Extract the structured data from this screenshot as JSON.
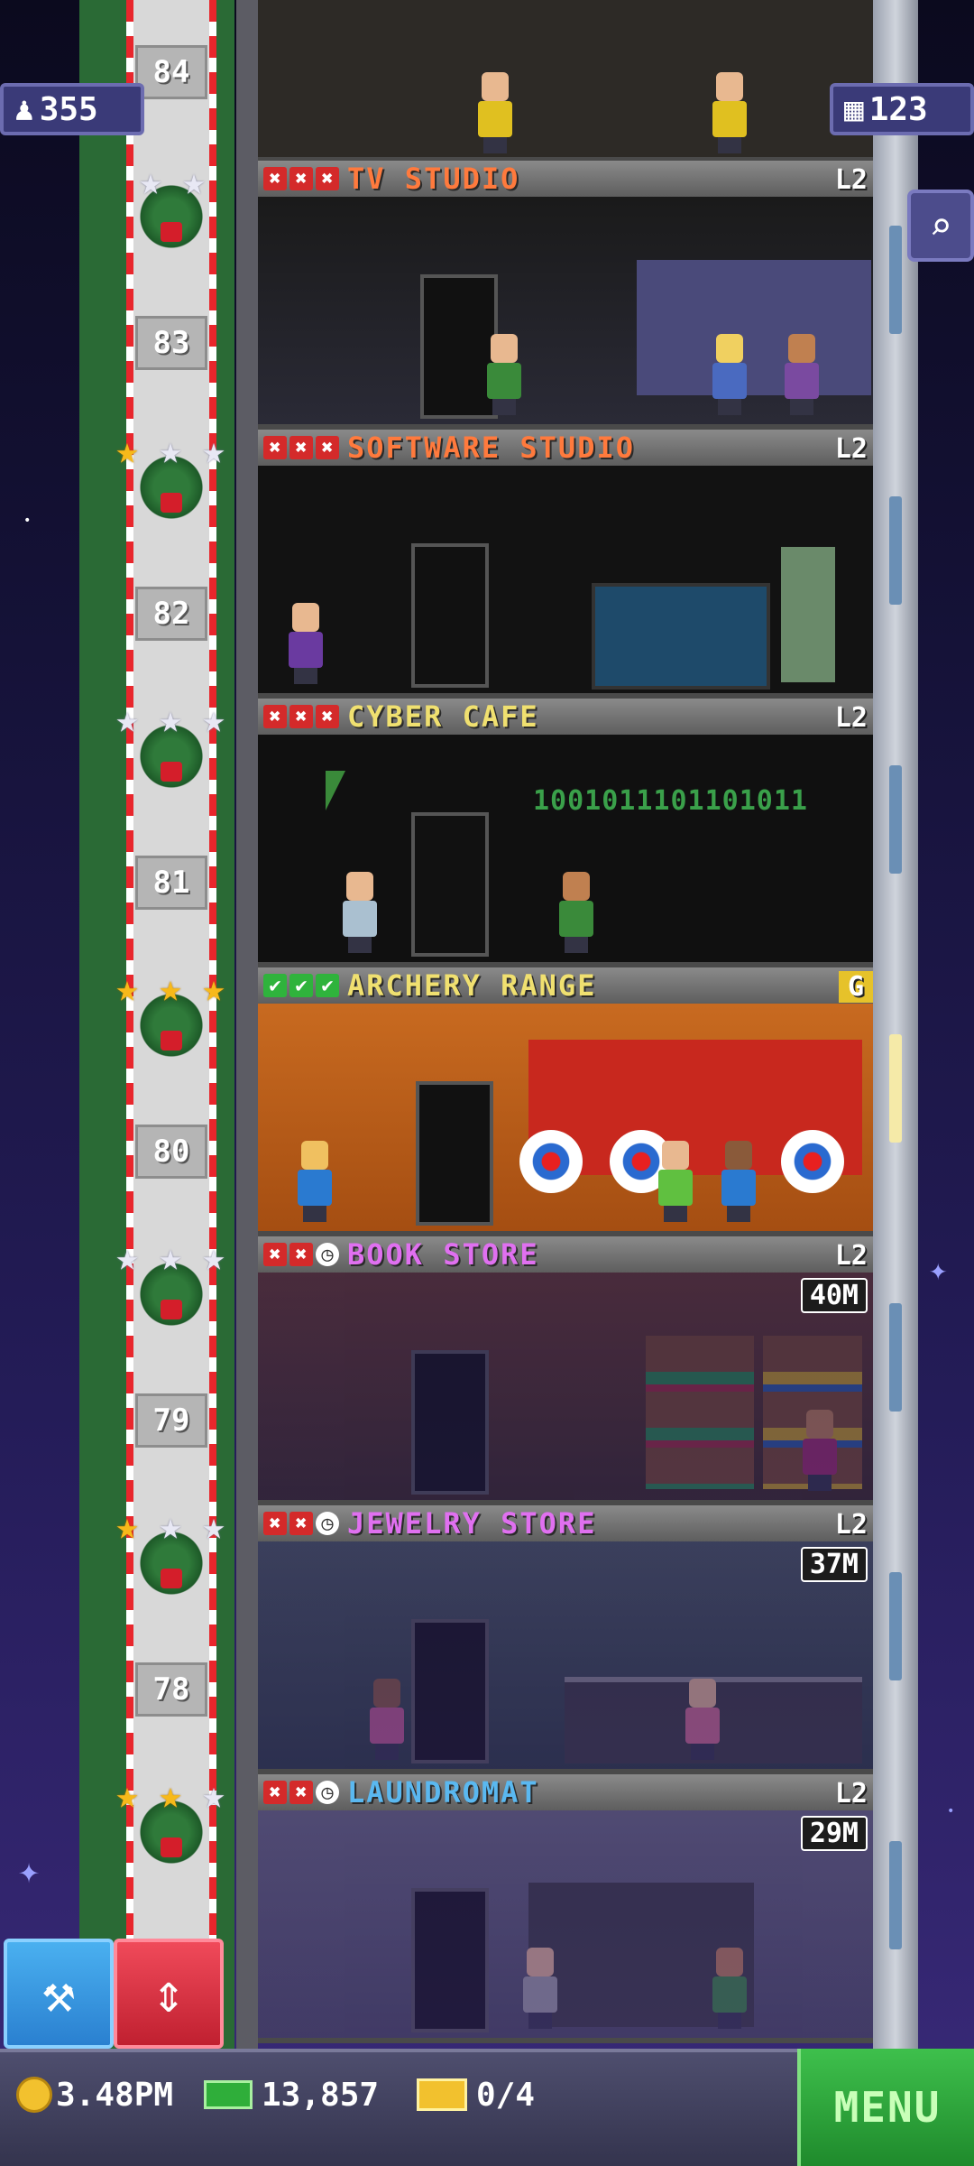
{
  "hud": {
    "population": "355",
    "population_icon": "person-icon",
    "floors": "123",
    "floors_icon": "building-icon"
  },
  "elevator": {
    "floor_numbers": [
      "84",
      "83",
      "82",
      "81",
      "80",
      "79",
      "78"
    ]
  },
  "floors": [
    {
      "name": "TV STUDIO",
      "color": "#ff7a3d",
      "status": [
        "x",
        "x",
        "x"
      ],
      "level": "L2",
      "timer": "",
      "stars": [
        "silver",
        "silver"
      ]
    },
    {
      "name": "SOFTWARE STUDIO",
      "color": "#ff7a3d",
      "status": [
        "x",
        "x",
        "x"
      ],
      "level": "L2",
      "timer": "",
      "stars": [
        "gold",
        "silver",
        "silver"
      ]
    },
    {
      "name": "CYBER CAFE",
      "color": "#f0e070",
      "status": [
        "x",
        "x",
        "x"
      ],
      "level": "L2",
      "timer": "",
      "stars": [
        "silver",
        "silver",
        "silver"
      ]
    },
    {
      "name": "ARCHERY RANGE",
      "color": "#f0e070",
      "status": [
        "ok",
        "ok",
        "ok"
      ],
      "level": "G",
      "timer": "",
      "stars": [
        "gold",
        "gold",
        "gold"
      ],
      "binary": ""
    },
    {
      "name": "BOOK STORE",
      "color": "#e070f0",
      "status": [
        "x",
        "x",
        "clock"
      ],
      "level": "L2",
      "timer": "40M",
      "stars": [
        "silver",
        "silver",
        "silver"
      ]
    },
    {
      "name": "JEWELRY STORE",
      "color": "#e070f0",
      "status": [
        "x",
        "x",
        "clock"
      ],
      "level": "L2",
      "timer": "37M",
      "stars": [
        "gold",
        "silver",
        "silver"
      ]
    },
    {
      "name": "LAUNDROMAT",
      "color": "#5ab8f0",
      "status": [
        "x",
        "x",
        "clock"
      ],
      "level": "L2",
      "timer": "29M",
      "stars": [
        "gold",
        "gold",
        "silver"
      ]
    }
  ],
  "cyber_cafe_binary": "1001011101101011",
  "bottom": {
    "coins": "3.48PM",
    "bux": "13,857",
    "tickets": "0/4",
    "menu_label": "MENU"
  },
  "tools": {
    "build_icon": "hammer-icon",
    "elevator_icon": "up-down-arrows-icon"
  }
}
